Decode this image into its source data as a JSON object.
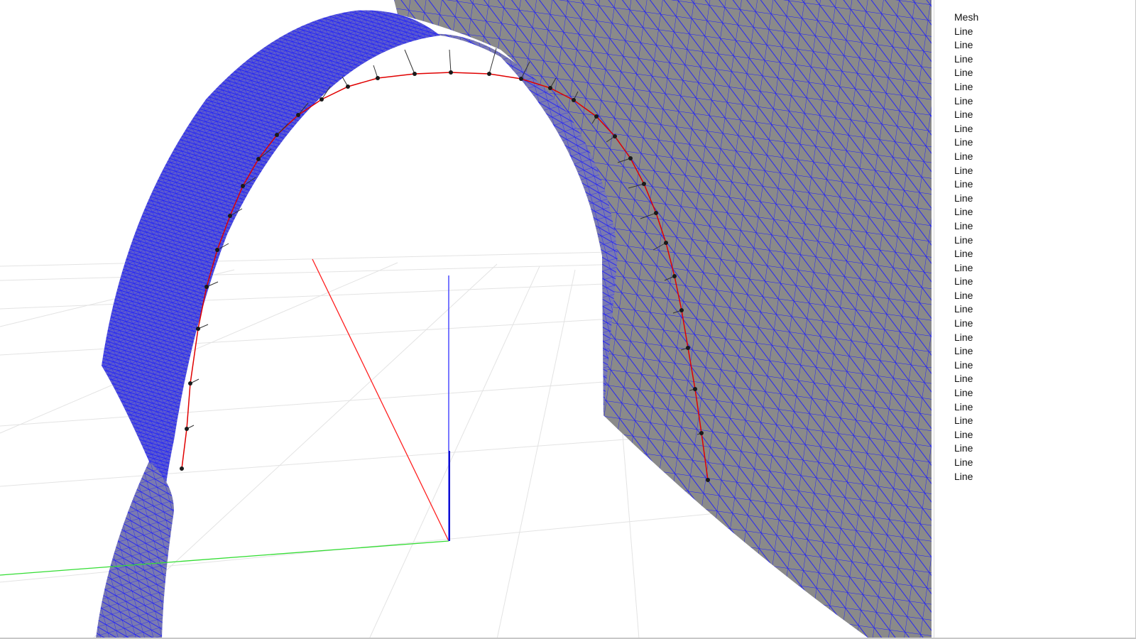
{
  "viewport": {
    "name": "3D viewport",
    "colors": {
      "background": "#ffffff",
      "grid": "#e3e3e3",
      "surface_fill": "#8a8a8a",
      "mesh_wire": "#1a1aff",
      "curve": "#e00000",
      "points": "#1a1a1a",
      "normals": "#333333",
      "axis_x": "#ff0000",
      "axis_y": "#00dd00",
      "axis_z": "#0000ff"
    }
  },
  "scene_panel": {
    "items": [
      {
        "label": "Mesh"
      },
      {
        "label": "Line"
      },
      {
        "label": "Line"
      },
      {
        "label": "Line"
      },
      {
        "label": "Line"
      },
      {
        "label": "Line"
      },
      {
        "label": "Line"
      },
      {
        "label": "Line"
      },
      {
        "label": "Line"
      },
      {
        "label": "Line"
      },
      {
        "label": "Line"
      },
      {
        "label": "Line"
      },
      {
        "label": "Line"
      },
      {
        "label": "Line"
      },
      {
        "label": "Line"
      },
      {
        "label": "Line"
      },
      {
        "label": "Line"
      },
      {
        "label": "Line"
      },
      {
        "label": "Line"
      },
      {
        "label": "Line"
      },
      {
        "label": "Line"
      },
      {
        "label": "Line"
      },
      {
        "label": "Line"
      },
      {
        "label": "Line"
      },
      {
        "label": "Line"
      },
      {
        "label": "Line"
      },
      {
        "label": "Line"
      },
      {
        "label": "Line"
      },
      {
        "label": "Line"
      },
      {
        "label": "Line"
      },
      {
        "label": "Line"
      },
      {
        "label": "Line"
      },
      {
        "label": "Line"
      },
      {
        "label": "Line"
      }
    ]
  }
}
